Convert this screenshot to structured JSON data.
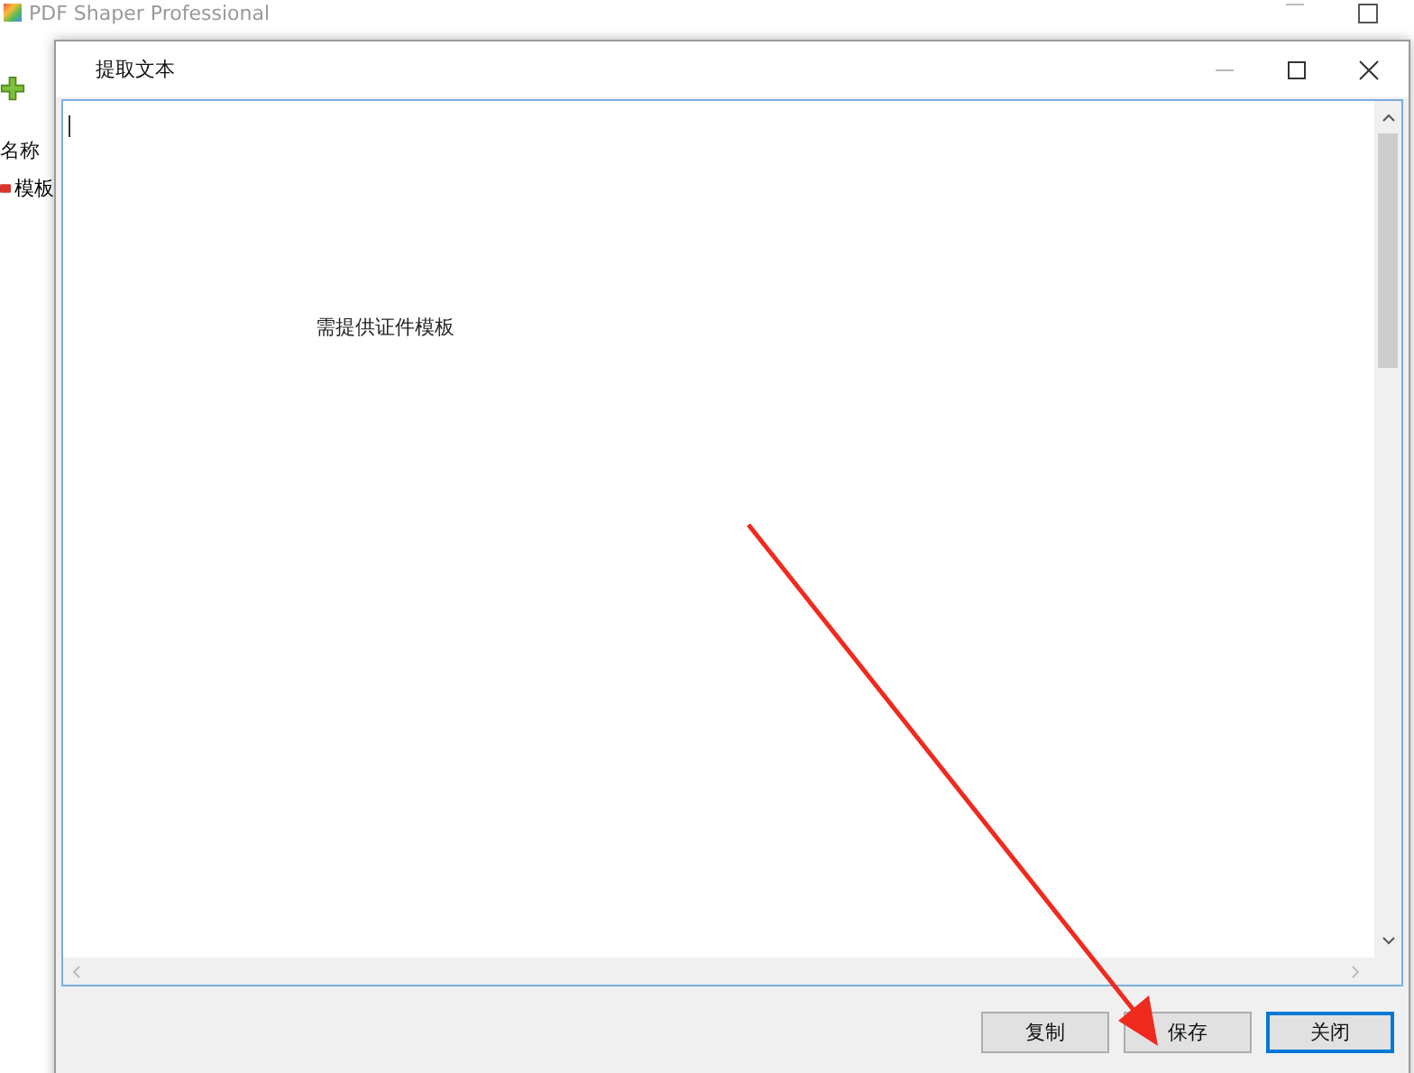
{
  "main_window": {
    "title": "PDF Shaper Professional",
    "column_header": "名称",
    "items": [
      {
        "label": "模板"
      }
    ]
  },
  "dialog": {
    "title": "提取文本",
    "text": "需提供证件模板",
    "buttons": [
      {
        "label": "复制",
        "default": false
      },
      {
        "label": "保存",
        "default": false
      },
      {
        "label": "关闭",
        "default": true
      }
    ]
  }
}
